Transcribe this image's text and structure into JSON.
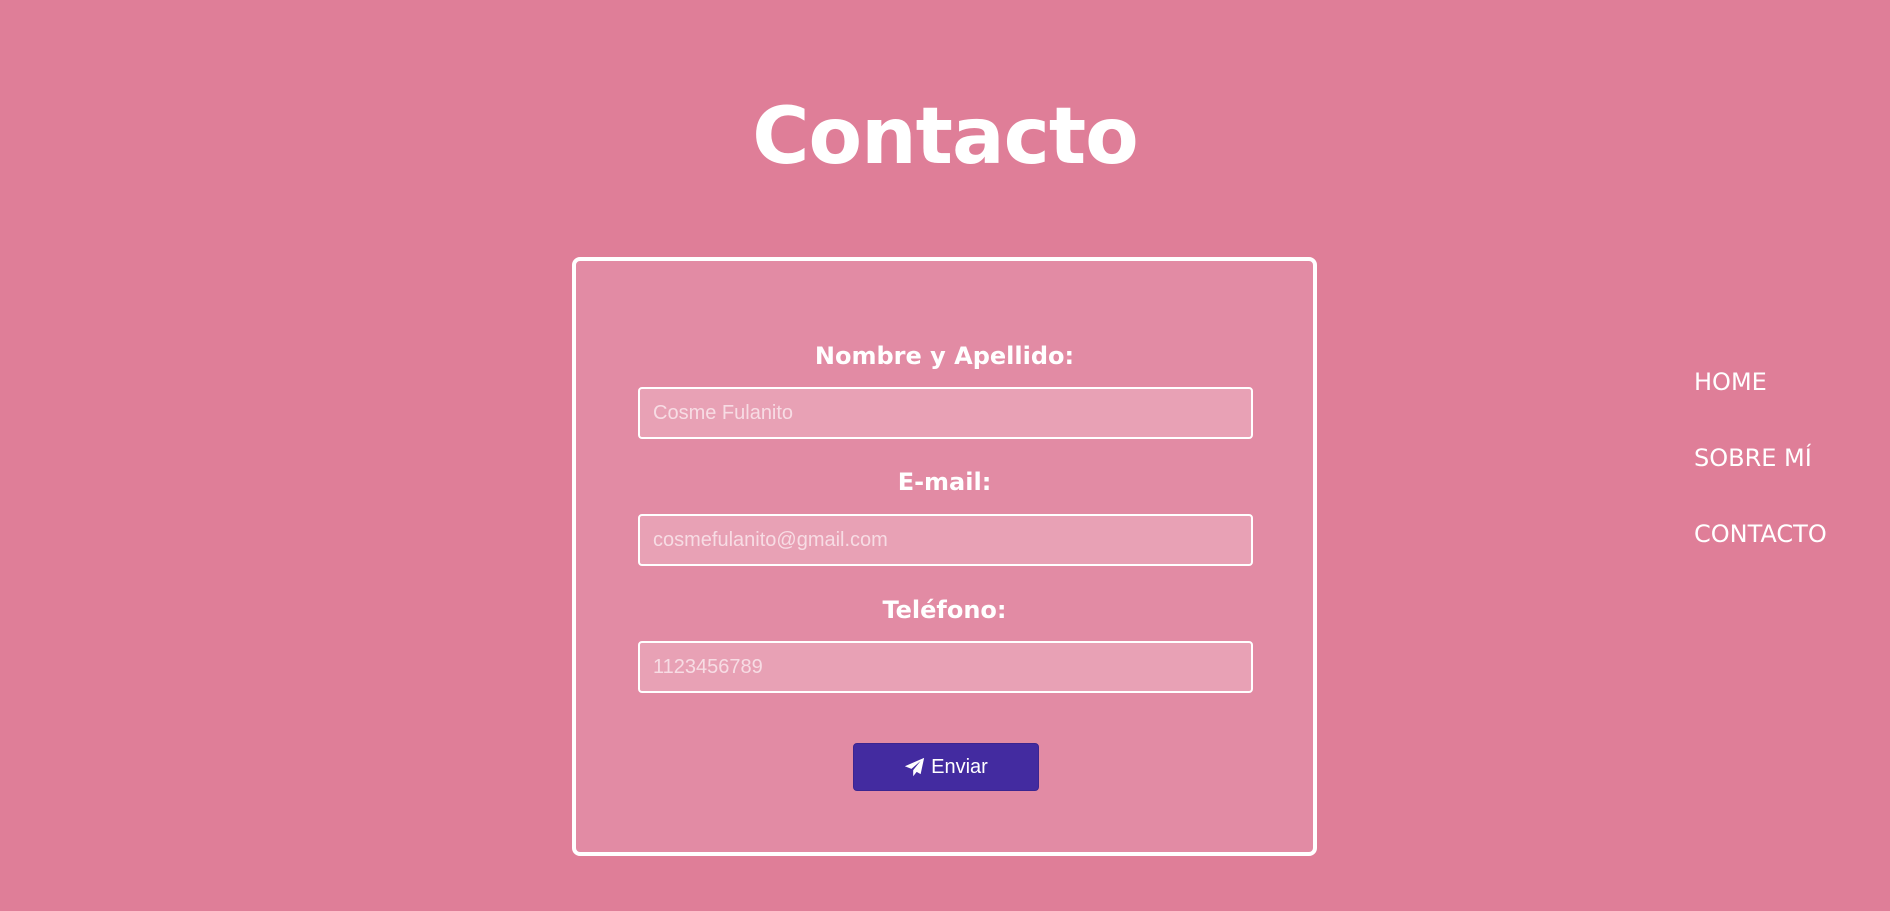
{
  "page": {
    "title": "Contacto"
  },
  "form": {
    "name_label": "Nombre y Apellido:",
    "name_placeholder": "Cosme Fulanito",
    "email_label": "E-mail:",
    "email_placeholder": "cosmefulanito@gmail.com",
    "phone_label": "Teléfono:",
    "phone_placeholder": "1123456789",
    "submit_label": "Enviar",
    "submit_icon": "paper-plane-icon"
  },
  "nav": {
    "items": [
      {
        "label": "HOME"
      },
      {
        "label": "SOBRE MÍ"
      },
      {
        "label": "CONTACTO"
      }
    ]
  },
  "colors": {
    "background": "#df7e98",
    "card_background": "#e28ba4",
    "input_background": "#e8a1b5",
    "button": "#432ba0",
    "text": "#ffffff"
  }
}
